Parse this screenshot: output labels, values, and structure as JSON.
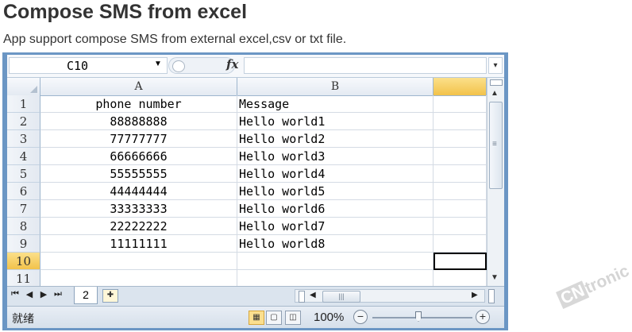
{
  "page": {
    "title": "Compose SMS from excel",
    "description": "App support compose SMS from external excel,csv or txt file."
  },
  "excel": {
    "name_box": "C10",
    "formula_value": "",
    "columns": [
      "A",
      "B"
    ],
    "rows": [
      {
        "num": "1",
        "a": "phone number",
        "b": "Message"
      },
      {
        "num": "2",
        "a": "88888888",
        "b": "Hello world1"
      },
      {
        "num": "3",
        "a": "77777777",
        "b": "Hello world2"
      },
      {
        "num": "4",
        "a": "66666666",
        "b": "Hello world3"
      },
      {
        "num": "5",
        "a": "55555555",
        "b": "Hello world4"
      },
      {
        "num": "6",
        "a": "44444444",
        "b": "Hello world5"
      },
      {
        "num": "7",
        "a": "33333333",
        "b": "Hello world6"
      },
      {
        "num": "8",
        "a": "22222222",
        "b": "Hello world7"
      },
      {
        "num": "9",
        "a": "11111111",
        "b": "Hello world8"
      },
      {
        "num": "10",
        "a": "",
        "b": ""
      },
      {
        "num": "11",
        "a": "",
        "b": ""
      }
    ],
    "active_row": "10",
    "sheet_tab": "2",
    "status": "就绪",
    "zoom": "100%",
    "zoom_level": 1.0
  },
  "watermark": {
    "cn": "CN",
    "tronic": "tronic"
  },
  "colors": {
    "frame": "#6b96c4",
    "header_selected": "#f2c24a",
    "active_view": "#fbdf8f"
  }
}
